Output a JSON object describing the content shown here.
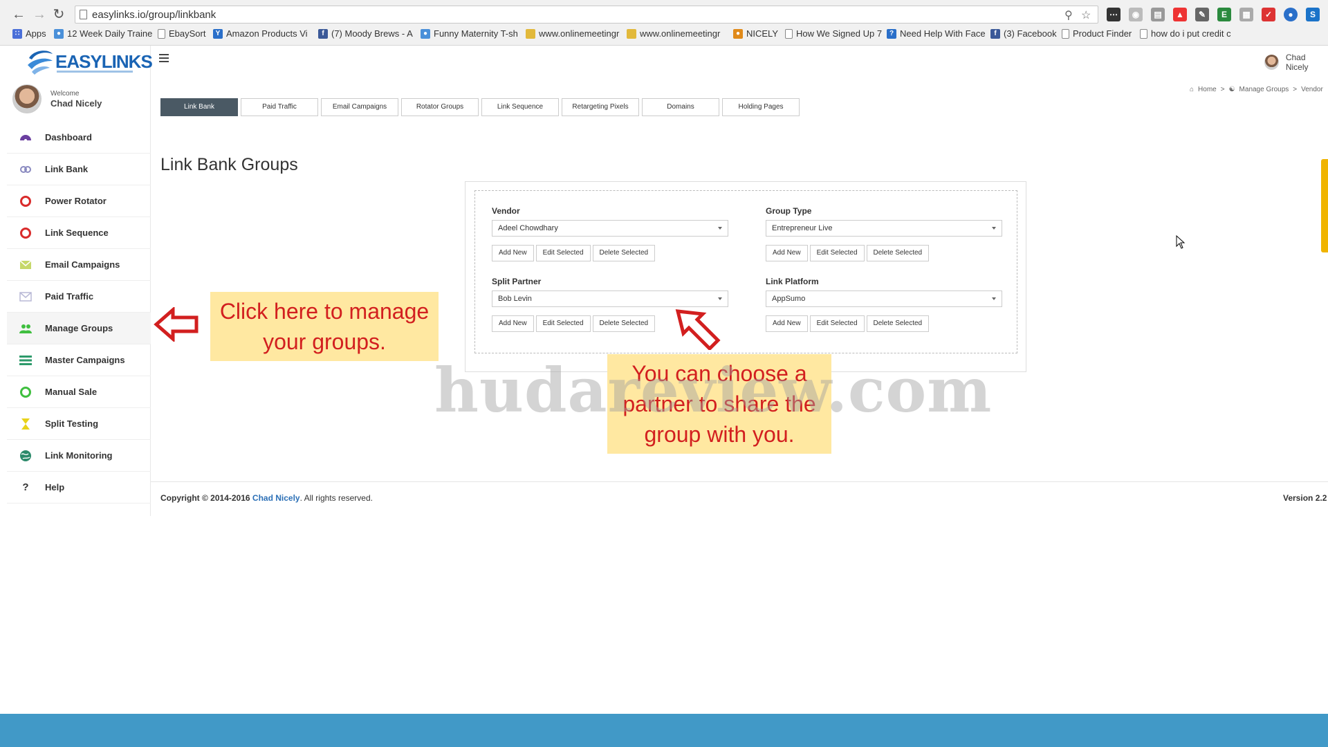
{
  "browser": {
    "url": "easylinks.io/group/linkbank",
    "bookmarks": [
      {
        "label": "Apps",
        "icon": "apps-grid-icon"
      },
      {
        "label": "12 Week Daily Traine",
        "icon": "bookmark-icon"
      },
      {
        "label": "EbaySort",
        "icon": "page-icon"
      },
      {
        "label": "Amazon Products Vi",
        "icon": "y-icon"
      },
      {
        "label": "(7) Moody Brews - A",
        "icon": "facebook-icon"
      },
      {
        "label": "Funny Maternity T-sh",
        "icon": "bookmark-icon"
      },
      {
        "label": "www.onlinemeetingr",
        "icon": "folder-icon"
      },
      {
        "label": "www.onlinemeetingr",
        "icon": "folder-icon"
      },
      {
        "label": "NICELY",
        "icon": "nicely-icon"
      },
      {
        "label": "How We Signed Up 7",
        "icon": "page-icon"
      },
      {
        "label": "Need Help With Face",
        "icon": "help-icon"
      },
      {
        "label": "(3) Facebook",
        "icon": "facebook-icon"
      },
      {
        "label": "Product Finder",
        "icon": "page-icon"
      },
      {
        "label": "how do i put credit c",
        "icon": "page-icon"
      }
    ]
  },
  "brand": {
    "logo_text": "EASYLINKS"
  },
  "user": {
    "welcome": "Welcome",
    "name": "Chad Nicely",
    "top_name": "Chad Nicely"
  },
  "sidebar": {
    "items": [
      {
        "label": "Dashboard",
        "icon": "dashboard-icon",
        "color": "#6b3fa0"
      },
      {
        "label": "Link Bank",
        "icon": "link-icon",
        "color": "#8a8ac0"
      },
      {
        "label": "Power Rotator",
        "icon": "ring-icon",
        "color": "#d92b2b"
      },
      {
        "label": "Link Sequence",
        "icon": "ring-icon",
        "color": "#d92b2b"
      },
      {
        "label": "Email Campaigns",
        "icon": "envelope-icon",
        "color": "#c6d86a"
      },
      {
        "label": "Paid Traffic",
        "icon": "envelope-outline-icon",
        "color": "#b9b9d6"
      },
      {
        "label": "Manage Groups",
        "icon": "users-icon",
        "color": "#3fbf3f"
      },
      {
        "label": "Master Campaigns",
        "icon": "list-icon",
        "color": "#2d9a6b"
      },
      {
        "label": "Manual Sale",
        "icon": "ring-icon",
        "color": "#3fbf3f"
      },
      {
        "label": "Split Testing",
        "icon": "hourglass-icon",
        "color": "#e8d21a"
      },
      {
        "label": "Link Monitoring",
        "icon": "globe-icon",
        "color": "#2d8a6b"
      },
      {
        "label": "Help",
        "icon": "question-icon",
        "color": "#333333"
      }
    ]
  },
  "breadcrumb": {
    "home": "Home",
    "section": "Manage Groups",
    "current": "Vendor"
  },
  "tabs": [
    {
      "label": "Link Bank",
      "active": true
    },
    {
      "label": "Paid Traffic"
    },
    {
      "label": "Email Campaigns"
    },
    {
      "label": "Rotator Groups"
    },
    {
      "label": "Link Sequence"
    },
    {
      "label": "Retargeting Pixels"
    },
    {
      "label": "Domains"
    },
    {
      "label": "Holding Pages"
    }
  ],
  "page_title": "Link Bank Groups",
  "buttons": {
    "add": "Add New",
    "edit": "Edit Selected",
    "delete": "Delete Selected"
  },
  "fields": {
    "vendor": {
      "label": "Vendor",
      "value": "Adeel Chowdhary"
    },
    "group_type": {
      "label": "Group Type",
      "value": "Entrepreneur Live"
    },
    "split_partner": {
      "label": "Split Partner",
      "value": "Bob Levin"
    },
    "link_platform": {
      "label": "Link Platform",
      "value": "AppSumo"
    }
  },
  "callouts": {
    "manage_line1": "Click here to manage",
    "manage_line2": "your groups.",
    "partner_line1": "You can choose a",
    "partner_line2": "partner to share the",
    "partner_line3": "group with you."
  },
  "watermark": "hudareview.com",
  "footer": {
    "prefix": "Copyright © 2014-2016",
    "author": "Chad Nicely",
    "suffix": ". All rights reserved.",
    "version": "Version 2.2"
  },
  "colors": {
    "accent": "#1a64b4",
    "tab_active": "#4a5964",
    "callout_bg": "#ffe8a1",
    "callout_text": "#d21f1f",
    "taskbar": "#4199c7"
  }
}
